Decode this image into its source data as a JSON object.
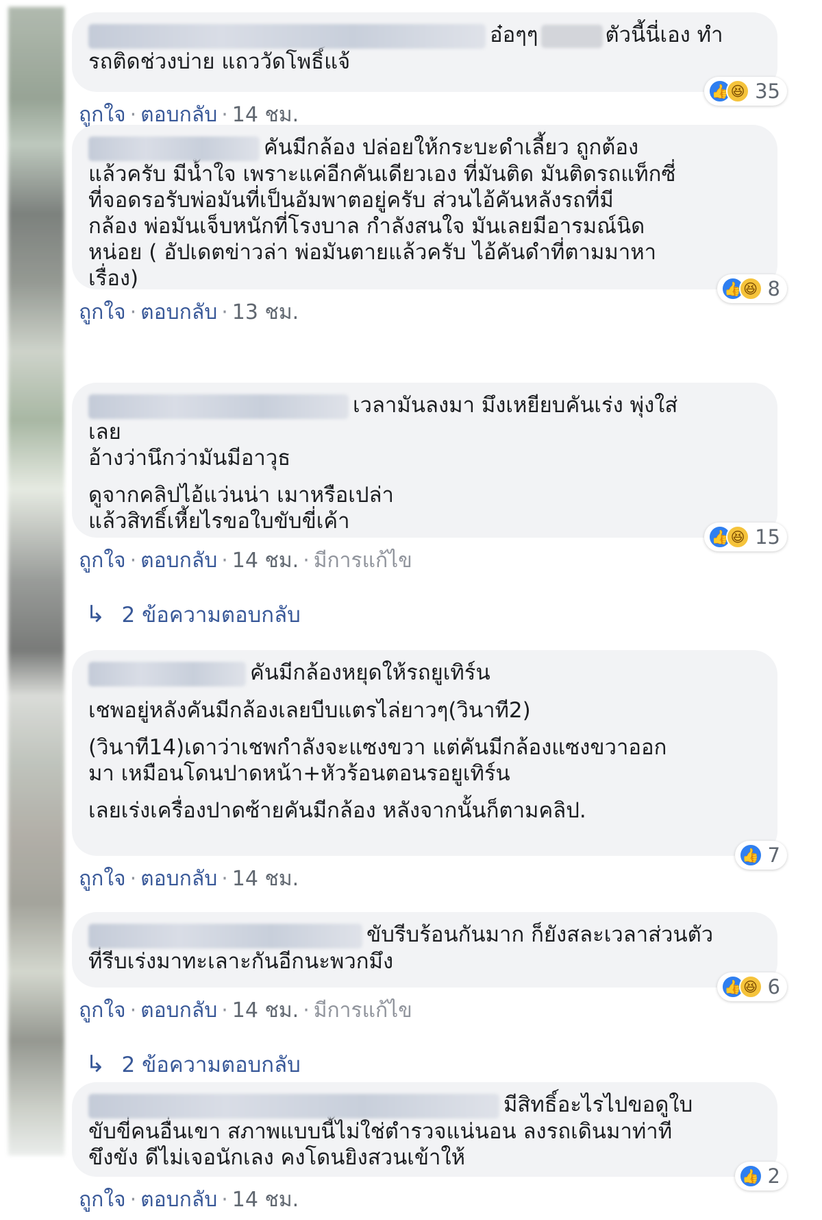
{
  "comments": [
    {
      "lines": [
        "อ๋อๆๆ",
        "ตัวนี้นี่เอง ทำ",
        "รถติดช่วงบ่าย แถววัดโพธิ์แจ้"
      ],
      "reaction_count": "35",
      "actions": {
        "like": "ถูกใจ",
        "reply": "ตอบกลับ",
        "time": "14 ชม."
      }
    },
    {
      "lines": [
        "คันมีกล้อง ปล่อยให้กระบะดำเลี้ยว ถูกต้อง",
        "แล้วครับ มีน้ำใจ เพราะแค่อีกคันเดียวเอง ที่มันติด มันติดรถแท็กซี่",
        "ที่จอดรอรับพ่อมันที่เป็นอัมพาตอยู่ครับ ส่วนไอ้คันหลังรถที่มี",
        "กล้อง พ่อมันเจ็บหนักที่โรงบาล กำลังสนใจ มันเลยมีอารมณ์นิด",
        "หน่อย ( อัปเดตข่าวล่า พ่อมันตายแล้วครับ ไอ้คันดำที่ตามมาหา",
        "เรื่อง)"
      ],
      "reaction_count": "8",
      "actions": {
        "like": "ถูกใจ",
        "reply": "ตอบกลับ",
        "time": "13 ชม."
      }
    },
    {
      "lines": [
        "เวลามันลงมา มึงเหยียบคันเร่ง พุ่งใส่",
        "เลย",
        "อ้างว่านึกว่ามันมีอาวุธ",
        "ดูจากคลิปไอ้แว่นน่า เมาหรือเปล่า",
        "แล้วสิทธิ์เหี้ยไรขอใบขับขี่เค้า"
      ],
      "reaction_count": "15",
      "actions": {
        "like": "ถูกใจ",
        "reply": "ตอบกลับ",
        "time": "14 ชม.",
        "edited": "มีการแก้ไข"
      },
      "replies_label": "2 ข้อความตอบกลับ"
    },
    {
      "lines": [
        "คันมีกล้องหยุดให้รถยูเทิร์น",
        "เชพอยู่หลังคันมีกล้องเลยบีบแตรไล่ยาวๆ(วินาที2)",
        "(วินาที14)เดาว่าเชพกำลังจะแซงขวา แต่คันมีกล้องแซงขวาออก",
        "มา เหมือนโดนปาดหน้า+หัวร้อนตอนรอยูเทิร์น",
        "เลยเร่งเครื่องปาดซ้ายคันมีกล้อง หลังจากนั้นก็ตามคลิป."
      ],
      "reaction_count": "7",
      "actions": {
        "like": "ถูกใจ",
        "reply": "ตอบกลับ",
        "time": "14 ชม."
      }
    },
    {
      "lines": [
        "ขับรีบร้อนกันมาก ก็ยังสละเวลาส่วนตัว",
        "ที่รีบเร่งมาทะเลาะกันอีกนะพวกมึง"
      ],
      "reaction_count": "6",
      "actions": {
        "like": "ถูกใจ",
        "reply": "ตอบกลับ",
        "time": "14 ชม.",
        "edited": "มีการแก้ไข"
      },
      "replies_label": "2 ข้อความตอบกลับ"
    },
    {
      "lines": [
        "มีสิทธิ์อะไรไปขอดูใบ",
        "ขับขี่คนอื่นเขา สภาพแบบนี้ไม่ใช่ตำรวจแน่นอน ลงรถเดินมาท่าที",
        "ขึงขัง ดีไม่เจอนักเลง คงโดนยิงสวนเข้าให้"
      ],
      "reaction_count": "2",
      "actions": {
        "like": "ถูกใจ",
        "reply": "ตอบกลับ",
        "time": "14 ชม."
      }
    }
  ],
  "colors": {
    "link": "#385898",
    "bubble": "#f2f3f5",
    "like": "#2f7ff0",
    "haha": "#f5c33b"
  },
  "icons": {
    "like": "thumbs-up-icon",
    "haha": "laughing-face-icon",
    "reply_arrow": "reply-arrow-icon"
  }
}
